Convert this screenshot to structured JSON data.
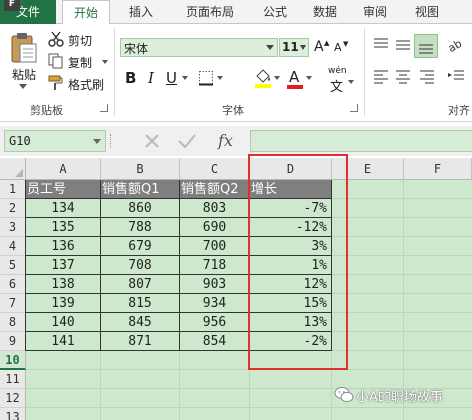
{
  "ribbon": {
    "tabs": [
      "文件",
      "开始",
      "插入",
      "页面布局",
      "公式",
      "数据",
      "审阅",
      "视图"
    ],
    "file_badge": "F",
    "clipboard": {
      "paste": "粘贴",
      "cut": "剪切",
      "copy": "复制",
      "format_painter": "格式刷",
      "group_label": "剪贴板"
    },
    "font": {
      "name": "宋体",
      "size": "11",
      "group_label": "字体",
      "increase_label": "A",
      "decrease_label": "A",
      "bold": "B",
      "italic": "I",
      "underline": "U",
      "font_color_letter": "A",
      "wen_label": "wén",
      "wen_char": "文"
    },
    "align_group_label": "对齐"
  },
  "formula_bar": {
    "name_box": "G10",
    "fx_label": "fx",
    "formula": ""
  },
  "sheet": {
    "columns": [
      "A",
      "B",
      "C",
      "D",
      "E",
      "F"
    ],
    "rows": [
      "1",
      "2",
      "3",
      "4",
      "5",
      "6",
      "7",
      "8",
      "9",
      "10",
      "11",
      "12",
      "13"
    ],
    "selected_row": "10",
    "headers": [
      "员工号",
      "销售额Q1",
      "销售额Q2",
      "增长"
    ],
    "data": [
      [
        "134",
        "860",
        "803",
        "-7%"
      ],
      [
        "135",
        "788",
        "690",
        "-12%"
      ],
      [
        "136",
        "679",
        "700",
        "3%"
      ],
      [
        "137",
        "708",
        "718",
        "1%"
      ],
      [
        "138",
        "807",
        "903",
        "12%"
      ],
      [
        "139",
        "815",
        "934",
        "15%"
      ],
      [
        "140",
        "845",
        "956",
        "13%"
      ],
      [
        "141",
        "871",
        "854",
        "-2%"
      ]
    ]
  },
  "watermark": "小A的职场故事",
  "colors": {
    "excel_green": "#217346",
    "sheet_bg": "#cde8cd",
    "header_fill": "#7f7f7f",
    "highlight_red": "#e0302a",
    "font_color_bar": "#e02020",
    "fill_color_bar": "#ffff00"
  },
  "icons": [
    "scissors-icon",
    "copy-icon",
    "format-painter-icon",
    "cancel-icon",
    "enter-icon",
    "fill-bucket-icon",
    "align-icon",
    "wrap-icon",
    "pinyin-icon"
  ]
}
